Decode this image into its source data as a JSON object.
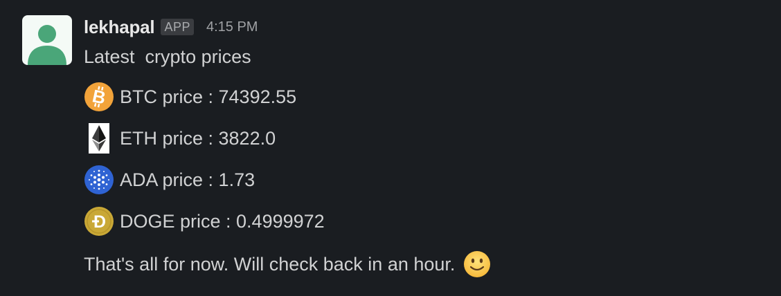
{
  "message": {
    "sender": "lekhapal",
    "badge": "APP",
    "timestamp": "4:15 PM",
    "intro": "Latest  crypto prices",
    "prices": [
      {
        "icon": "bitcoin-icon",
        "text": "BTC price : 74392.55"
      },
      {
        "icon": "ethereum-icon",
        "text": "ETH price : 3822.0"
      },
      {
        "icon": "cardano-icon",
        "text": "ADA price : 1.73"
      },
      {
        "icon": "dogecoin-icon",
        "text": "DOGE price : 0.4999972"
      }
    ],
    "outro": "That's all for now. Will check back in an hour.",
    "emoji": "slightly-smiling-face-emoji"
  },
  "colors": {
    "background": "#1a1d21",
    "text": "#d1d2d3",
    "avatar_bg": "#f4faf6",
    "avatar_figure": "#4aa679",
    "bitcoin": "#f2a33a",
    "cardano": "#2f63d3",
    "dogecoin": "#c9a836"
  }
}
